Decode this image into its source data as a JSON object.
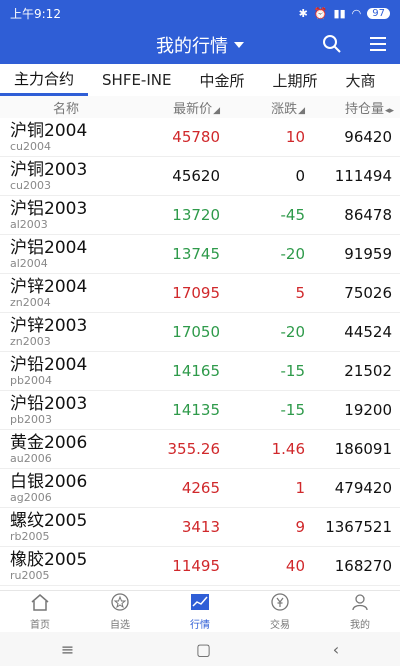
{
  "status": {
    "time": "上午9:12",
    "battery": "97"
  },
  "header": {
    "title": "我的行情"
  },
  "tabs": [
    {
      "label": "主力合约"
    },
    {
      "label": "SHFE-INE"
    },
    {
      "label": "中金所"
    },
    {
      "label": "上期所"
    },
    {
      "label": "大商"
    }
  ],
  "columns": {
    "name": "名称",
    "price": "最新价",
    "change": "涨跌",
    "oi": "持仓量"
  },
  "rows": [
    {
      "name": "沪铜2004",
      "code": "cu2004",
      "price": "45780",
      "change": "10",
      "oi": "96420",
      "dir": "up"
    },
    {
      "name": "沪铜2003",
      "code": "cu2003",
      "price": "45620",
      "change": "0",
      "oi": "111494",
      "dir": "flat"
    },
    {
      "name": "沪铝2003",
      "code": "al2003",
      "price": "13720",
      "change": "-45",
      "oi": "86478",
      "dir": "down"
    },
    {
      "name": "沪铝2004",
      "code": "al2004",
      "price": "13745",
      "change": "-20",
      "oi": "91959",
      "dir": "down"
    },
    {
      "name": "沪锌2004",
      "code": "zn2004",
      "price": "17095",
      "change": "5",
      "oi": "75026",
      "dir": "up"
    },
    {
      "name": "沪锌2003",
      "code": "zn2003",
      "price": "17050",
      "change": "-20",
      "oi": "44524",
      "dir": "down"
    },
    {
      "name": "沪铅2004",
      "code": "pb2004",
      "price": "14165",
      "change": "-15",
      "oi": "21502",
      "dir": "down"
    },
    {
      "name": "沪铅2003",
      "code": "pb2003",
      "price": "14135",
      "change": "-15",
      "oi": "19200",
      "dir": "down"
    },
    {
      "name": "黄金2006",
      "code": "au2006",
      "price": "355.26",
      "change": "1.46",
      "oi": "186091",
      "dir": "up"
    },
    {
      "name": "白银2006",
      "code": "ag2006",
      "price": "4265",
      "change": "1",
      "oi": "479420",
      "dir": "up"
    },
    {
      "name": "螺纹2005",
      "code": "rb2005",
      "price": "3413",
      "change": "9",
      "oi": "1367521",
      "dir": "up"
    },
    {
      "name": "橡胶2005",
      "code": "ru2005",
      "price": "11495",
      "change": "40",
      "oi": "168270",
      "dir": "up"
    }
  ],
  "nav": [
    {
      "label": "首页",
      "icon": "home-icon"
    },
    {
      "label": "自选",
      "icon": "star-icon"
    },
    {
      "label": "行情",
      "icon": "chart-icon",
      "active": true
    },
    {
      "label": "交易",
      "icon": "yen-icon"
    },
    {
      "label": "我的",
      "icon": "user-icon"
    }
  ],
  "colors": {
    "brand": "#2f5ed6",
    "up": "#d0282b",
    "down": "#2e9a4a"
  }
}
